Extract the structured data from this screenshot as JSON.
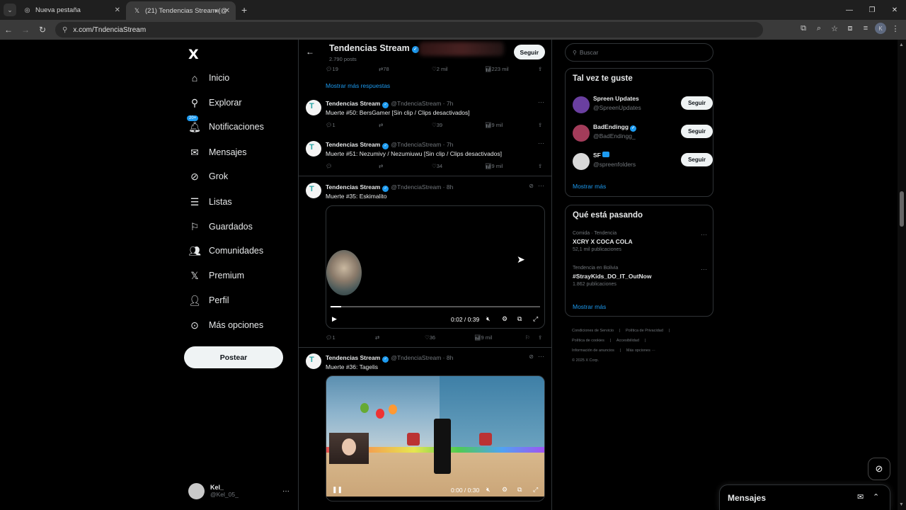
{
  "browser": {
    "tabs": [
      {
        "title": "Nueva pestaña",
        "active": false
      },
      {
        "title": "(21) Tendencias Stream (@",
        "active": true
      }
    ],
    "url": "x.com/TndenciaStream",
    "profile_initial": "K"
  },
  "leftnav": {
    "logo": "X",
    "items": [
      {
        "label": "Inicio",
        "icon": "home-icon"
      },
      {
        "label": "Explorar",
        "icon": "search-icon"
      },
      {
        "label": "Notificaciones",
        "icon": "bell-icon",
        "badge": "20+"
      },
      {
        "label": "Mensajes",
        "icon": "mail-icon"
      },
      {
        "label": "Grok",
        "icon": "grok-icon"
      },
      {
        "label": "Listas",
        "icon": "list-icon"
      },
      {
        "label": "Guardados",
        "icon": "bookmark-icon"
      },
      {
        "label": "Comunidades",
        "icon": "people-icon"
      },
      {
        "label": "Premium",
        "icon": "x-icon"
      },
      {
        "label": "Perfil",
        "icon": "person-icon"
      },
      {
        "label": "Más opciones",
        "icon": "more-circle-icon"
      }
    ],
    "post_button": "Postear",
    "account": {
      "name": "Kel_",
      "handle": "@Kel_05_"
    }
  },
  "header": {
    "title": "Tendencias Stream",
    "posts": "2.790 posts",
    "follow": "Seguir"
  },
  "feed": {
    "top_actions": {
      "replies": "19",
      "reposts": "78",
      "likes": "2 mil",
      "views": "223 mil"
    },
    "show_more_replies": "Mostrar más respuestas",
    "tweets": [
      {
        "name": "Tendencias Stream",
        "handle": "@TndenciaStream · 7h",
        "text": "Muerte #50: BersGamer [Sin clip / Clips desactivados]",
        "replies": "1",
        "reposts": "",
        "likes": "39",
        "views": "9 mil"
      },
      {
        "name": "Tendencias Stream",
        "handle": "@TndenciaStream · 7h",
        "text": "Muerte #51: Nezumivy / Nezumiuwu [Sin clip / Clips desactivados]",
        "replies": "",
        "reposts": "",
        "likes": "34",
        "views": "9 mil"
      },
      {
        "name": "Tendencias Stream",
        "handle": "@TndenciaStream · 8h",
        "text": "Muerte #35: Eskimalito",
        "video_time": "0:02 / 0:39",
        "replies": "1",
        "reposts": "",
        "likes": "36",
        "views": "9 mil"
      },
      {
        "name": "Tendencias Stream",
        "handle": "@TndenciaStream · 8h",
        "text": "Muerte #36: Tagelis",
        "video_time": "0:00 / 0:30"
      }
    ]
  },
  "right": {
    "search_placeholder": "Buscar",
    "suggest_title": "Tal vez te guste",
    "suggestions": [
      {
        "name": "Spreen Updates",
        "handle": "@SpreenUpdates",
        "follow": "Seguir",
        "color": "#6a3fa0"
      },
      {
        "name": "BadEndingg",
        "handle": "@BadEndingg_",
        "follow": "Seguir",
        "color": "#a33c5a"
      },
      {
        "name": "SF",
        "handle": "@spreenfolders",
        "follow": "Seguir",
        "color": "#d9d9d9"
      }
    ],
    "show_more": "Mostrar más",
    "trending_title": "Qué está pasando",
    "trends": [
      {
        "category": "Comida · Tendencia",
        "name": "XCRY X COCA COLA",
        "count": "52,1 mil publicaciones"
      },
      {
        "category": "Tendencia en Bolivia",
        "name": "#StrayKids_DO_IT_OutNow",
        "count": "1.862 publicaciones"
      }
    ],
    "footer": [
      "Condiciones de Servicio",
      "Política de Privacidad",
      "Política de cookies",
      "Accesibilidad",
      "Información de anuncios",
      "Más opciones ···",
      "© 2025 X Corp."
    ]
  },
  "messages": {
    "title": "Mensajes"
  },
  "colors": {
    "accent": "#1d9bf0",
    "bg": "#000000",
    "border": "#2f3336"
  }
}
